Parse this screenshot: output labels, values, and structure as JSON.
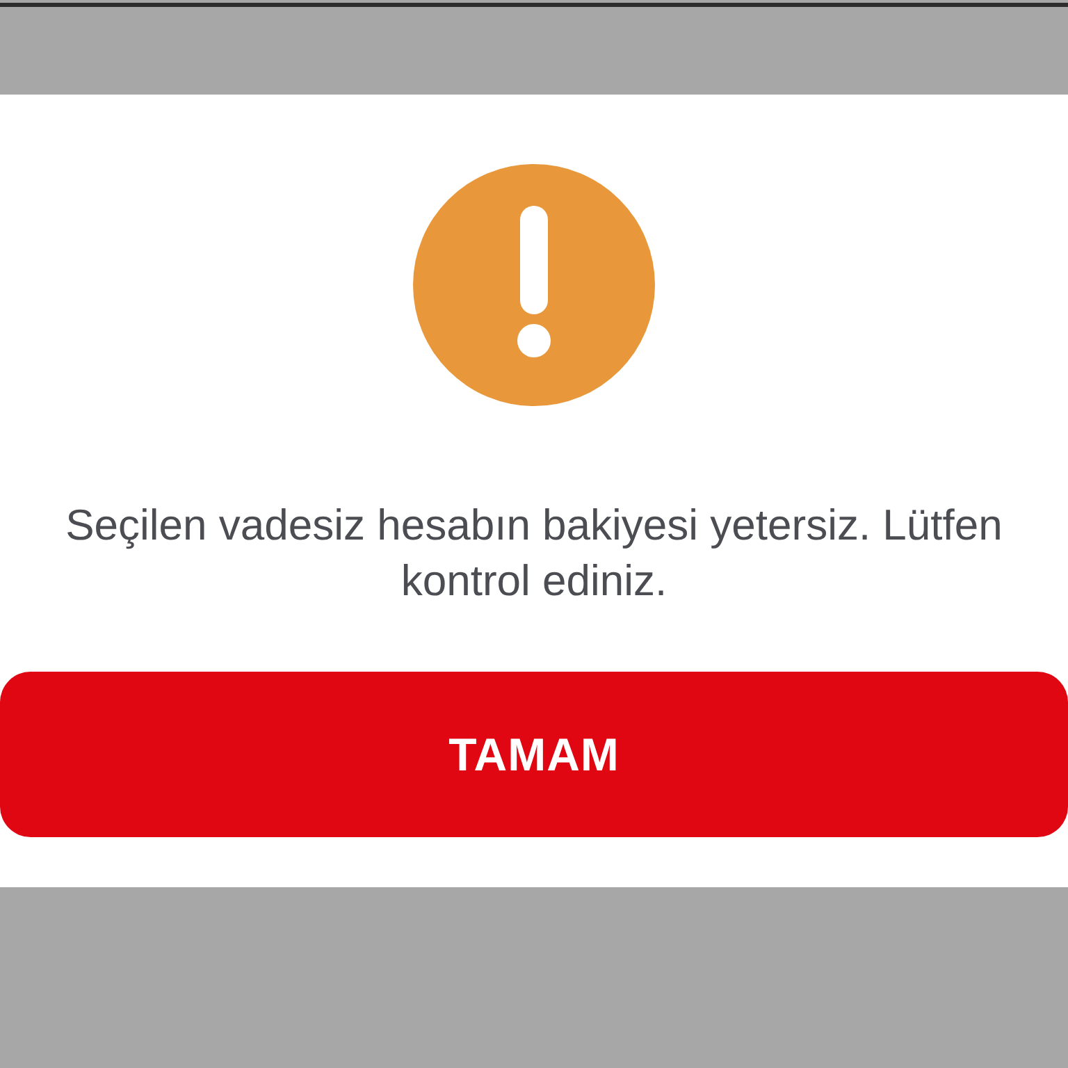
{
  "dialog": {
    "message": "Seçilen vadesiz hesabın bakiyesi yetersiz. Lütfen kontrol ediniz.",
    "buttons": [
      {
        "label": "TAMAM"
      }
    ]
  }
}
